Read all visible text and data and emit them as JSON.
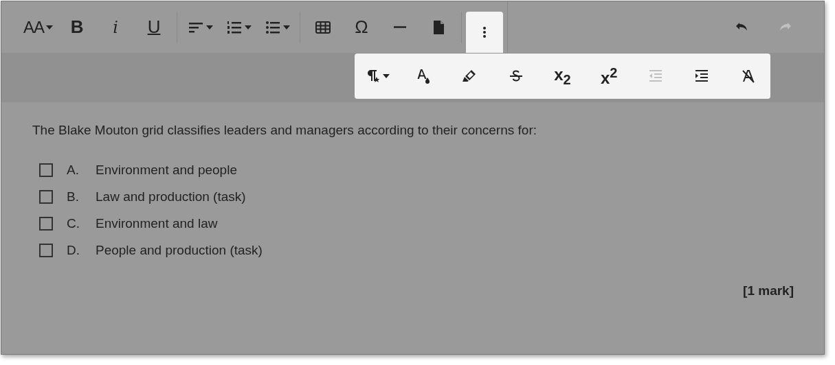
{
  "toolbar": {
    "groups": [
      {
        "items": [
          {
            "kind": "font-size",
            "label": "AA",
            "caret": true,
            "disabled": false
          },
          {
            "kind": "bold",
            "label": "B",
            "caret": false,
            "disabled": false
          },
          {
            "kind": "italic",
            "label": "i",
            "caret": false,
            "disabled": false
          },
          {
            "kind": "underline",
            "label": "U",
            "caret": false,
            "disabled": false
          }
        ]
      },
      {
        "items": [
          {
            "kind": "align",
            "caret": true,
            "disabled": false
          },
          {
            "kind": "numbered-list",
            "caret": true,
            "disabled": false
          },
          {
            "kind": "bullet-list",
            "caret": true,
            "disabled": false
          }
        ]
      },
      {
        "items": [
          {
            "kind": "table",
            "caret": false,
            "disabled": false
          },
          {
            "kind": "special-char",
            "label": "Ω",
            "caret": false,
            "disabled": false
          },
          {
            "kind": "rule",
            "caret": false,
            "disabled": false
          },
          {
            "kind": "page",
            "caret": false,
            "disabled": false
          }
        ]
      },
      {
        "items": [
          {
            "kind": "more",
            "expanded": true
          }
        ]
      }
    ],
    "history": [
      {
        "kind": "undo",
        "disabled": false
      },
      {
        "kind": "redo",
        "disabled": true
      }
    ]
  },
  "more_panel": {
    "items": [
      {
        "kind": "paragraph-style",
        "caret": true,
        "disabled": false
      },
      {
        "kind": "text-color",
        "caret": false,
        "disabled": false
      },
      {
        "kind": "highlight",
        "caret": false,
        "disabled": false
      },
      {
        "kind": "strikethrough",
        "caret": false,
        "disabled": false
      },
      {
        "kind": "subscript",
        "label": "x$_{2}$",
        "caret": false,
        "disabled": false
      },
      {
        "kind": "superscript",
        "label": "x$^{2}$",
        "caret": false,
        "disabled": false
      },
      {
        "kind": "outdent",
        "caret": false,
        "disabled": true
      },
      {
        "kind": "indent",
        "caret": false,
        "disabled": false
      },
      {
        "kind": "clear-format",
        "caret": false,
        "disabled": false
      }
    ]
  },
  "question": {
    "text": "The Blake Mouton grid classifies leaders and managers according to their concerns for:",
    "options": [
      {
        "letter": "A.",
        "text": "Environment and people",
        "checked": false
      },
      {
        "letter": "B.",
        "text": "Law and production (task)",
        "checked": false
      },
      {
        "letter": "C.",
        "text": "Environment and law",
        "checked": false
      },
      {
        "letter": "D.",
        "text": "People and production (task)",
        "checked": false
      }
    ],
    "marks": "[1 mark]"
  }
}
